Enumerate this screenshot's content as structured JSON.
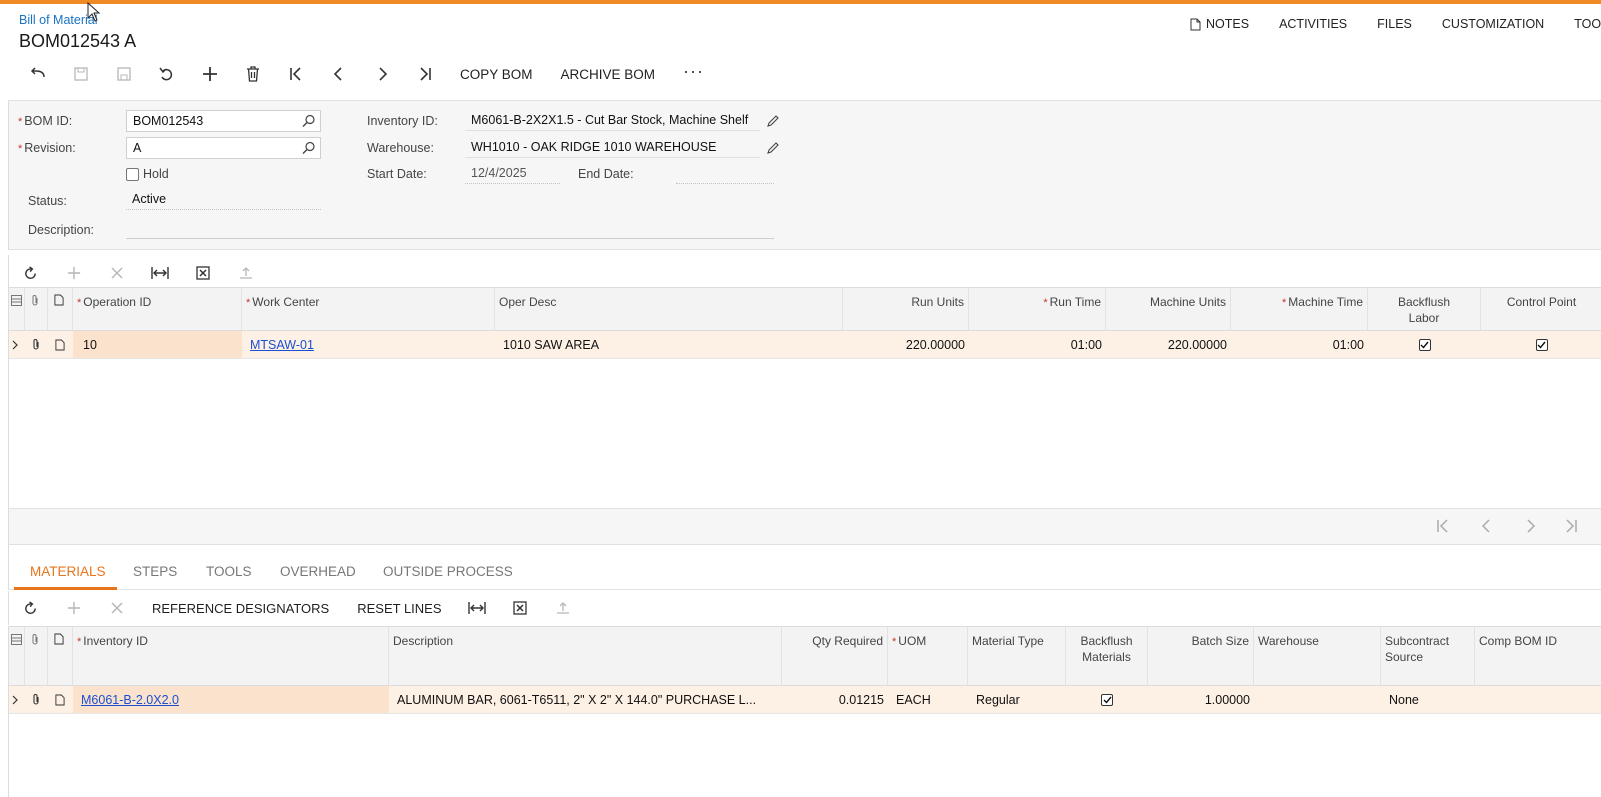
{
  "breadcrumb": "Bill of Material",
  "title": "BOM012543 A",
  "header_links": {
    "notes": "NOTES",
    "activities": "ACTIVITIES",
    "files": "FILES",
    "customization": "CUSTOMIZATION",
    "tools": "TOOLS"
  },
  "toolbar": {
    "copy_bom": "COPY BOM",
    "archive_bom": "ARCHIVE BOM",
    "more": "···"
  },
  "form": {
    "bom_id_label": "BOM ID:",
    "bom_id": "BOM012543",
    "revision_label": "Revision:",
    "revision": "A",
    "hold_label": "Hold",
    "status_label": "Status:",
    "status": "Active",
    "description_label": "Description:",
    "description": "",
    "inventory_id_label": "Inventory ID:",
    "inventory_id": "M6061-B-2X2X1.5 - Cut Bar Stock, Machine Shelf",
    "warehouse_label": "Warehouse:",
    "warehouse": "WH1010 - OAK RIDGE 1010 WAREHOUSE",
    "start_date_label": "Start Date:",
    "start_date": "12/4/2025",
    "end_date_label": "End Date:",
    "end_date": ""
  },
  "operations": {
    "headers": {
      "operation_id": "Operation ID",
      "work_center": "Work Center",
      "oper_desc": "Oper Desc",
      "run_units": "Run Units",
      "run_time": "Run Time",
      "machine_units": "Machine Units",
      "machine_time": "Machine Time",
      "backflush_labor_1": "Backflush",
      "backflush_labor_2": "Labor",
      "control_point": "Control Point"
    },
    "rows": [
      {
        "operation_id": "10",
        "work_center": "MTSAW-01",
        "oper_desc": "1010 SAW AREA",
        "run_units": "220.00000",
        "run_time": "01:00",
        "machine_units": "220.00000",
        "machine_time": "01:00",
        "backflush_labor": true,
        "control_point": true
      }
    ]
  },
  "tabs": {
    "materials": "MATERIALS",
    "steps": "STEPS",
    "tools": "TOOLS",
    "overhead": "OVERHEAD",
    "outside_process": "OUTSIDE PROCESS"
  },
  "materials_toolbar": {
    "reference_designators": "REFERENCE DESIGNATORS",
    "reset_lines": "RESET LINES"
  },
  "materials": {
    "headers": {
      "inventory_id": "Inventory ID",
      "description": "Description",
      "qty_required": "Qty Required",
      "uom": "UOM",
      "material_type": "Material Type",
      "backflush_materials_1": "Backflush",
      "backflush_materials_2": "Materials",
      "batch_size": "Batch Size",
      "warehouse": "Warehouse",
      "subcontract_source_1": "Subcontract",
      "subcontract_source_2": "Source",
      "comp_bom_id": "Comp BOM ID"
    },
    "rows": [
      {
        "inventory_id": "M6061-B-2.0X2.0",
        "description": "ALUMINUM BAR, 6061-T6511, 2\" X 2\" X 144.0\" PURCHASE L...",
        "qty_required": "0.01215",
        "uom": "EACH",
        "material_type": "Regular",
        "backflush_materials": true,
        "batch_size": "1.00000",
        "warehouse": "",
        "subcontract_source": "None",
        "comp_bom_id": ""
      }
    ]
  },
  "colors": {
    "accent": "#e8741c",
    "topbar": "#f08a24",
    "row_selected": "#fdf1e6",
    "link": "#1a4fd1"
  }
}
